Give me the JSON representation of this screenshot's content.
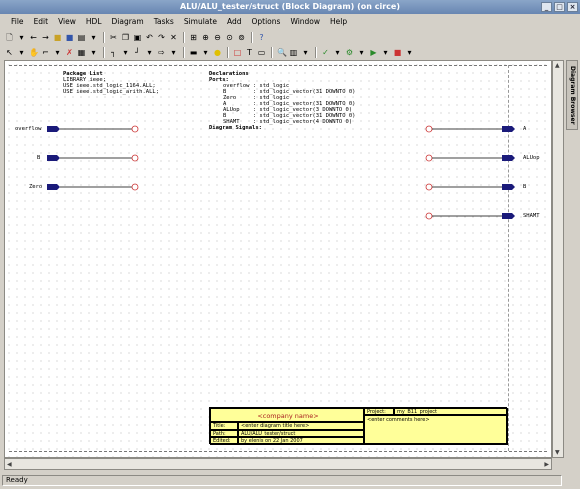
{
  "window": {
    "title": "ALU/ALU_tester/struct (Block Diagram) (on circe)"
  },
  "menu": [
    "File",
    "Edit",
    "View",
    "HDL",
    "Diagram",
    "Tasks",
    "Simulate",
    "Add",
    "Options",
    "Window",
    "Help"
  ],
  "sidebar": {
    "tab": "Diagram Browser"
  },
  "package_list": {
    "title": "Package List",
    "lines": [
      "LIBRARY ieee;",
      "USE ieee.std_logic_1164.ALL;",
      "USE ieee.std_logic_arith.ALL;"
    ]
  },
  "declarations": {
    "title": "Declarations",
    "ports_label": "Ports:",
    "ports": [
      "overflow : std_logic",
      "B        : std_logic_vector(31 DOWNTO 0)",
      "Zero     : std_logic",
      "A        : std_logic_vector(31 DOWNTO 0)",
      "ALUop    : std_logic_vector(3 DOWNTO 0)",
      "B        : std_logic_vector(31 DOWNTO 0)",
      "SHAMT    : std_logic_vector(4 DOWNTO 0)"
    ],
    "signals_label": "Diagram Signals:"
  },
  "left_ports": [
    "overflow",
    "B",
    "Zero"
  ],
  "right_ports": [
    "A",
    "ALUop",
    "B",
    "SHAMT"
  ],
  "title_block": {
    "company": "<company name>",
    "project_label": "Project:",
    "project_value": "my_B11_project",
    "comments": "<enter comments here>",
    "title_label": "Title:",
    "title_value": "<enter diagram title here>",
    "path_label": "Path:",
    "path_value": "ALU/ALU_tester/struct",
    "edited_label": "Edited:",
    "edited_value": "by elenis on 22 Jan 2007"
  },
  "status": {
    "text": "Ready"
  },
  "colors": {
    "port": "#1a1a7a",
    "open_end": "#cc3333",
    "title_block": "#ffff99"
  }
}
